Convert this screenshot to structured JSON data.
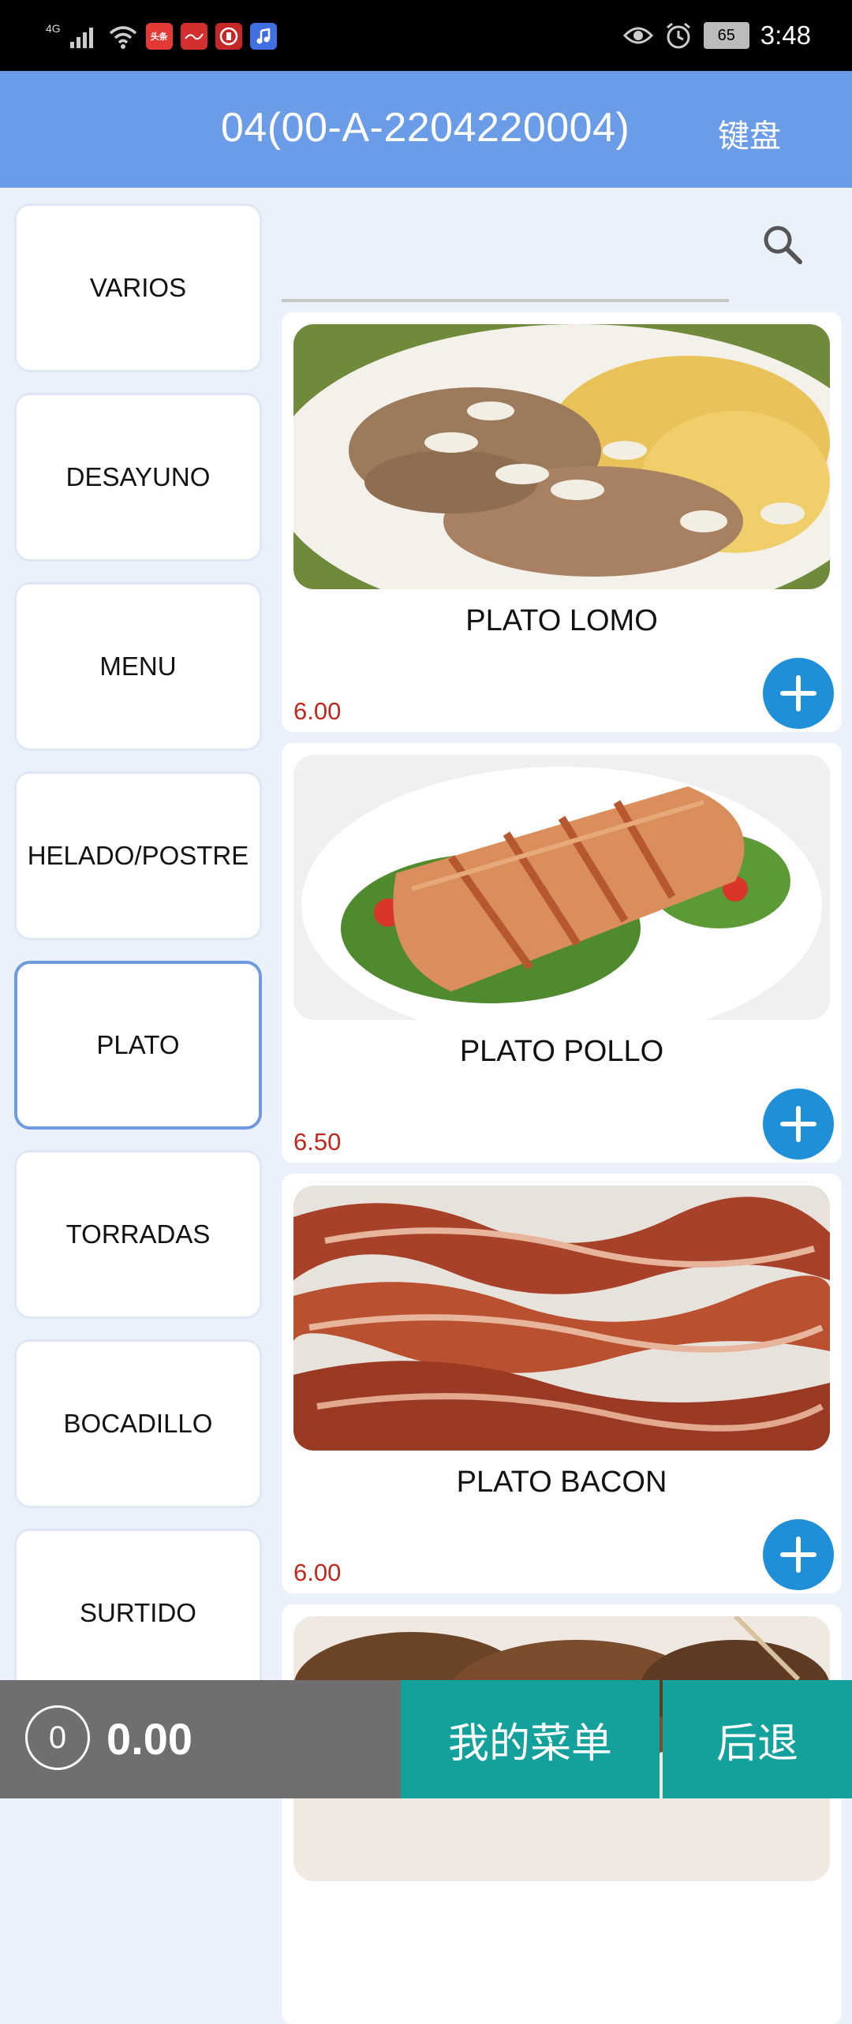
{
  "status_bar": {
    "network": "4G",
    "apps": [
      {
        "icon": "toutiao-app-icon",
        "label": "头条",
        "color": "#e53935"
      },
      {
        "icon": "red-app-icon",
        "label": "",
        "color": "#d32f2f"
      },
      {
        "icon": "bank-app-icon",
        "label": "",
        "color": "#c62828"
      },
      {
        "icon": "music-app-icon",
        "label": "",
        "color": "#3f6fe0"
      }
    ],
    "battery": "65",
    "time": "3:48"
  },
  "header": {
    "title": "04(00-A-2204220004)",
    "keyboard_label": "键盘",
    "color": "#6b9ce8"
  },
  "categories": [
    {
      "label": "VARIOS",
      "active": false
    },
    {
      "label": "DESAYUNO",
      "active": false
    },
    {
      "label": "MENU",
      "active": false
    },
    {
      "label": "HELADO/POSTRE",
      "active": false
    },
    {
      "label": "PLATO",
      "active": true
    },
    {
      "label": "TORRADAS",
      "active": false
    },
    {
      "label": "BOCADILLO",
      "active": false
    },
    {
      "label": "SURTIDO",
      "active": false
    }
  ],
  "products": [
    {
      "name": "PLATO LOMO",
      "price": "6.00",
      "image": "pork-loin-plate"
    },
    {
      "name": "PLATO POLLO",
      "price": "6.50",
      "image": "grilled-chicken-plate"
    },
    {
      "name": "PLATO BACON",
      "price": "6.00",
      "image": "bacon-plate"
    },
    {
      "name": "",
      "price": "",
      "image": "skewers-plate"
    }
  ],
  "bottom_bar": {
    "count": "0",
    "total": "0.00",
    "menu_label": "我的菜单",
    "back_label": "后退",
    "accent": "#14a19c"
  },
  "colors": {
    "price": "#c0281e",
    "add_button": "#1f8fd8"
  }
}
